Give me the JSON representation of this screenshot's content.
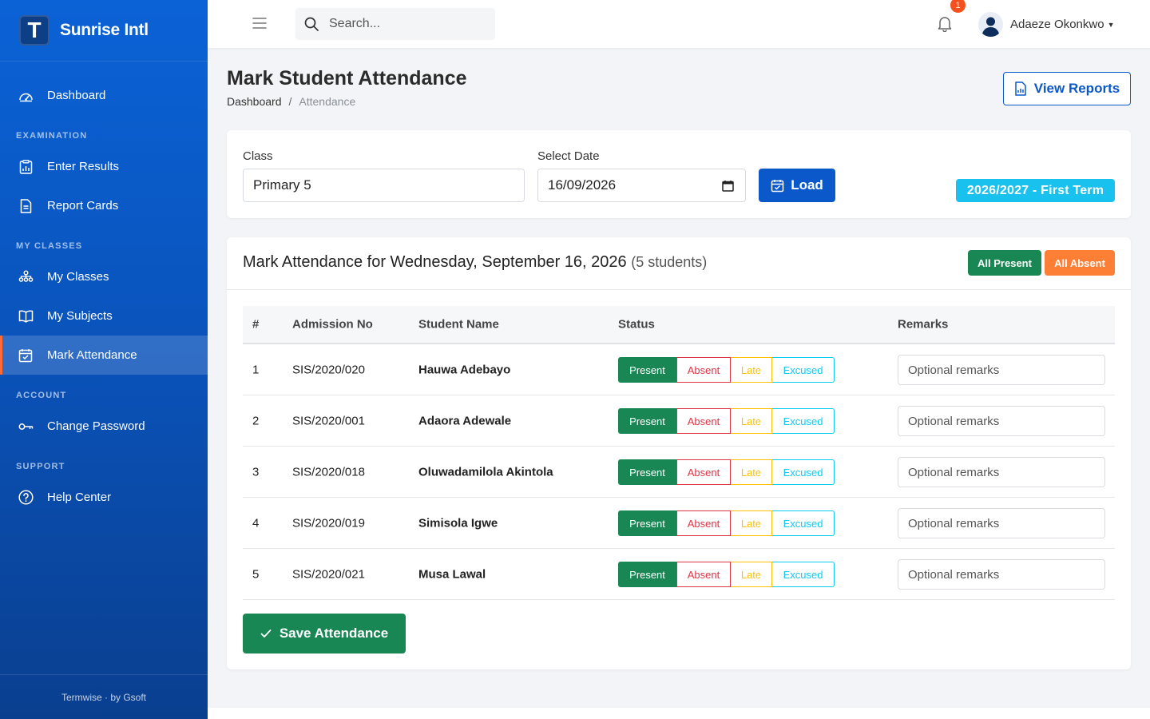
{
  "brand": {
    "logo_letter": "T",
    "name": "Sunrise Intl"
  },
  "sidebar": {
    "items": [
      {
        "type": "link",
        "label": "Dashboard",
        "icon": "dashboard-icon"
      },
      {
        "type": "section",
        "label": "EXAMINATION"
      },
      {
        "type": "link",
        "label": "Enter Results",
        "icon": "results-icon"
      },
      {
        "type": "link",
        "label": "Report Cards",
        "icon": "report-card-icon"
      },
      {
        "type": "section",
        "label": "MY CLASSES"
      },
      {
        "type": "link",
        "label": "My Classes",
        "icon": "classes-icon"
      },
      {
        "type": "link",
        "label": "My Subjects",
        "icon": "book-icon"
      },
      {
        "type": "link",
        "label": "Mark Attendance",
        "icon": "calendar-check-icon",
        "active": true
      },
      {
        "type": "section",
        "label": "ACCOUNT"
      },
      {
        "type": "link",
        "label": "Change Password",
        "icon": "key-icon"
      },
      {
        "type": "section",
        "label": "SUPPORT"
      },
      {
        "type": "link",
        "label": "Help Center",
        "icon": "help-icon"
      }
    ],
    "footer": "Termwise · by Gsoft"
  },
  "topbar": {
    "search_placeholder": "Search...",
    "notification_count": "1",
    "user_name": "Adaeze Okonkwo"
  },
  "page": {
    "title": "Mark Student Attendance",
    "breadcrumb": {
      "home": "Dashboard",
      "separator": "/",
      "current": "Attendance"
    },
    "view_reports_label": "View Reports"
  },
  "filters": {
    "class_label": "Class",
    "class_value": "Primary 5",
    "date_label": "Select Date",
    "date_value": "16/09/2026",
    "load_label": "Load",
    "term_badge": "2026/2027 - First Term"
  },
  "attendance": {
    "title": "Mark Attendance for Wednesday, September 16, 2026",
    "count_text": "(5 students)",
    "all_present_label": "All Present",
    "all_absent_label": "All Absent",
    "columns": [
      "#",
      "Admission No",
      "Student Name",
      "Status",
      "Remarks"
    ],
    "status_options": [
      "Present",
      "Absent",
      "Late",
      "Excused"
    ],
    "remarks_placeholder": "Optional remarks",
    "rows": [
      {
        "num": "1",
        "admission": "SIS/2020/020",
        "name": "Hauwa Adebayo",
        "status": "Present"
      },
      {
        "num": "2",
        "admission": "SIS/2020/001",
        "name": "Adaora Adewale",
        "status": "Present"
      },
      {
        "num": "3",
        "admission": "SIS/2020/018",
        "name": "Oluwadamilola Akintola",
        "status": "Present"
      },
      {
        "num": "4",
        "admission": "SIS/2020/019",
        "name": "Simisola Igwe",
        "status": "Present"
      },
      {
        "num": "5",
        "admission": "SIS/2020/021",
        "name": "Musa Lawal",
        "status": "Present"
      }
    ],
    "save_label": "Save Attendance"
  },
  "colors": {
    "primary": "#0a58ca",
    "success": "#198754",
    "danger": "#dc3545",
    "warning": "#ffc107",
    "info": "#0dcaf0",
    "orange": "#fd7e35",
    "term_badge": "#19c2ee"
  }
}
